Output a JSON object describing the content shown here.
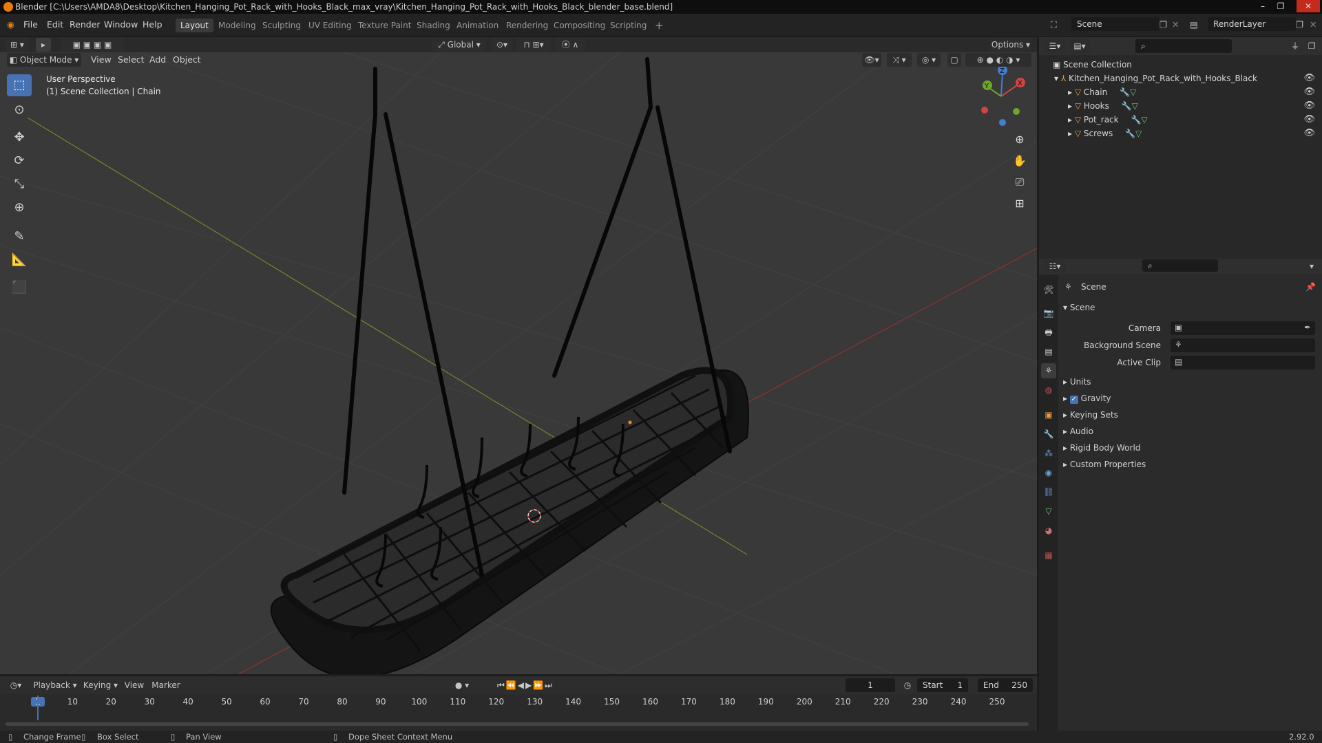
{
  "window": {
    "title": "Blender [C:\\Users\\AMDA8\\Desktop\\Kitchen_Hanging_Pot_Rack_with_Hooks_Black_max_vray\\Kitchen_Hanging_Pot_Rack_with_Hooks_Black_blender_base.blend]"
  },
  "menu": [
    "File",
    "Edit",
    "Render",
    "Window",
    "Help"
  ],
  "workspaces": [
    "Layout",
    "Modeling",
    "Sculpting",
    "UV Editing",
    "Texture Paint",
    "Shading",
    "Animation",
    "Rendering",
    "Compositing",
    "Scripting"
  ],
  "top": {
    "scene": "Scene",
    "view_layer": "RenderLayer"
  },
  "vp_header": {
    "transform": "Global",
    "options": "Options",
    "mode": "Object Mode",
    "menus": [
      "View",
      "Select",
      "Add",
      "Object"
    ]
  },
  "viewport": {
    "perspective": "User Perspective",
    "context": "(1) Scene Collection | Chain"
  },
  "outliner": {
    "root": "Scene Collection",
    "collection": "Kitchen_Hanging_Pot_Rack_with_Hooks_Black",
    "objects": [
      "Chain",
      "Hooks",
      "Pot_rack",
      "Screws"
    ]
  },
  "properties": {
    "context": "Scene",
    "panel": "Scene",
    "camera_label": "Camera",
    "bg_label": "Background Scene",
    "clip_label": "Active Clip",
    "sections": [
      "Units",
      "Gravity",
      "Keying Sets",
      "Audio",
      "Rigid Body World",
      "Custom Properties"
    ],
    "gravity_checked": true
  },
  "timeline": {
    "menus": [
      "Playback",
      "Keying",
      "View",
      "Marker"
    ],
    "current": "1",
    "start_label": "Start",
    "start": "1",
    "end_label": "End",
    "end": "250",
    "ticks": [
      "1",
      "10",
      "20",
      "30",
      "40",
      "50",
      "60",
      "70",
      "80",
      "90",
      "100",
      "110",
      "120",
      "130",
      "140",
      "150",
      "160",
      "170",
      "180",
      "190",
      "200",
      "210",
      "220",
      "230",
      "240",
      "250"
    ]
  },
  "status": {
    "change_frame": "Change Frame",
    "box_select": "Box Select",
    "pan_view": "Pan View",
    "context_menu": "Dope Sheet Context Menu",
    "version": "2.92.0"
  }
}
